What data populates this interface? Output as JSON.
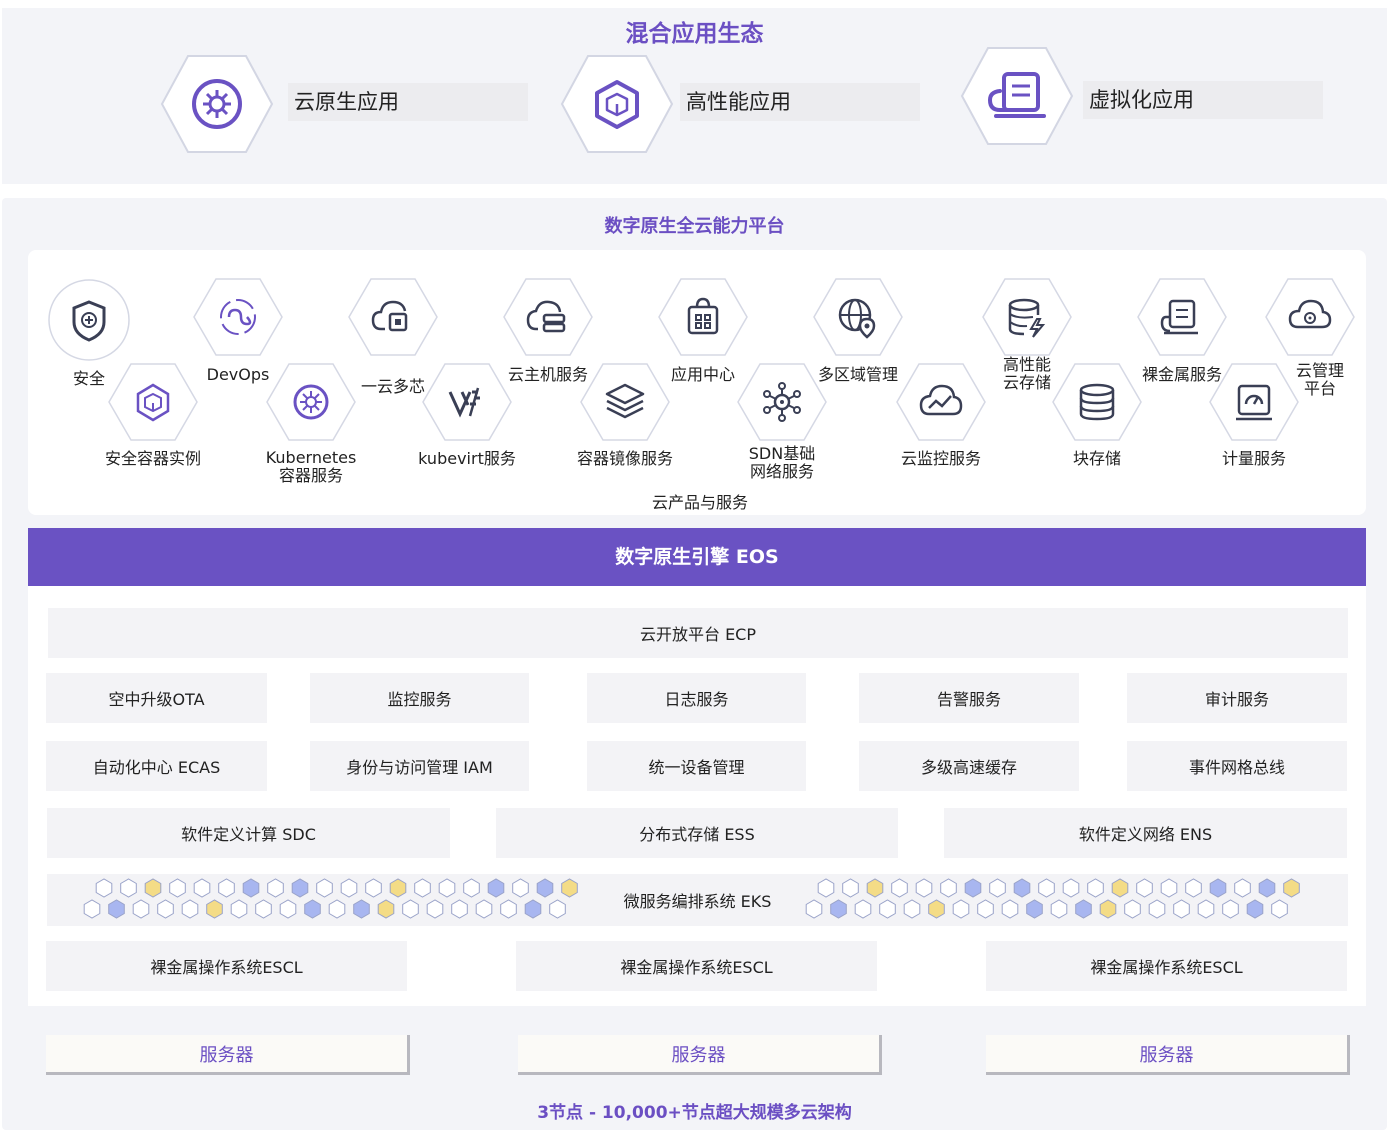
{
  "colors": {
    "accent": "#6a52c3",
    "title": "#6b4fc3",
    "hex_border": "#cfd3e3",
    "hex_blue": "#a8b6f0",
    "hex_yellow": "#f4dc86"
  },
  "mixed_ecosystem": {
    "title": "混合应用生态",
    "apps": [
      {
        "label": "云原生应用",
        "icon": "helm-wheel-icon"
      },
      {
        "label": "高性能应用",
        "icon": "cube-icon"
      },
      {
        "label": "虚拟化应用",
        "icon": "server-cloud-icon"
      }
    ]
  },
  "platform": {
    "title": "数字原生全云能力平台",
    "services": [
      {
        "label": "安全",
        "icon": "shield-plus-icon"
      },
      {
        "label": "DevOps",
        "icon": "devops-loop-icon"
      },
      {
        "label": "一云多芯",
        "icon": "cloud-chip-icon"
      },
      {
        "label": "云主机服务",
        "icon": "cloud-server-icon"
      },
      {
        "label": "应用中心",
        "icon": "app-bag-icon"
      },
      {
        "label": "多区域管理",
        "icon": "globe-pin-icon"
      },
      {
        "label": "高性能\n云存储",
        "icon": "database-bolt-icon"
      },
      {
        "label": "裸金属服务",
        "icon": "bare-metal-icon"
      },
      {
        "label": "云管理\n平台",
        "icon": "cloud-gear-icon"
      },
      {
        "label": "安全容器实例",
        "icon": "secure-cube-icon"
      },
      {
        "label": "Kubernetes\n容器服务",
        "icon": "kubernetes-icon"
      },
      {
        "label": "kubevirt服务",
        "icon": "kubevirt-icon"
      },
      {
        "label": "容器镜像服务",
        "icon": "layers-icon"
      },
      {
        "label": "SDN基础\n网络服务",
        "icon": "network-node-icon"
      },
      {
        "label": "云监控服务",
        "icon": "cloud-monitor-icon"
      },
      {
        "label": "块存储",
        "icon": "database-icon"
      },
      {
        "label": "计量服务",
        "icon": "meter-icon"
      }
    ],
    "caption": "云产品与服务"
  },
  "eos": {
    "title": "数字原生引擎 EOS",
    "ecp": "云开放平台 ECP",
    "row1": [
      "空中升级OTA",
      "监控服务",
      "日志服务",
      "告警服务",
      "审计服务"
    ],
    "row2": [
      "自动化中心 ECAS",
      "身份与访问管理 IAM",
      "统一设备管理",
      "多级高速缓存",
      "事件网格总线"
    ],
    "row3": [
      "软件定义计算 SDC",
      "分布式存储 ESS",
      "软件定义网络 ENS"
    ],
    "eks": "微服务编排系统 EKS",
    "row5": [
      "裸金属操作系统ESCL",
      "裸金属操作系统ESCL",
      "裸金属操作系统ESCL"
    ]
  },
  "servers": [
    "服务器",
    "服务器",
    "服务器"
  ],
  "footer": "3节点 - 10,000+节点超大规模多云架构"
}
